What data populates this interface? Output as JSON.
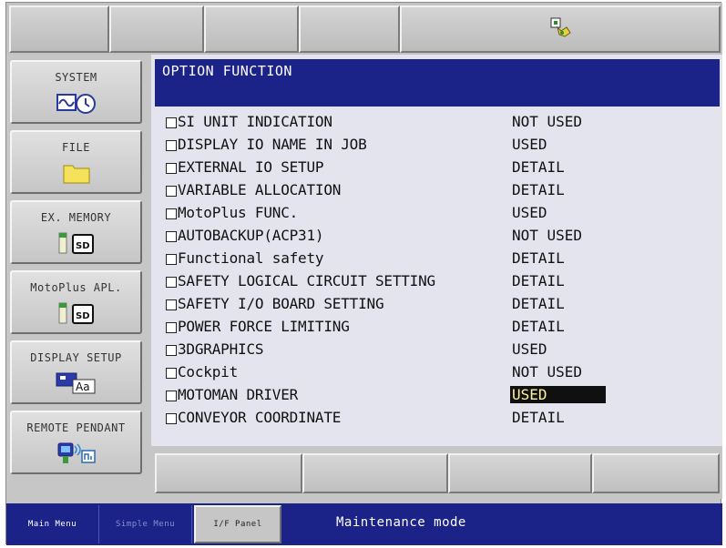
{
  "header": {
    "status_icon": "robot-status-icon"
  },
  "left_menu": {
    "items": [
      {
        "label": "SYSTEM",
        "icon": "system-clock-icon"
      },
      {
        "label": "FILE",
        "icon": "folder-icon"
      },
      {
        "label": "EX. MEMORY",
        "icon": "sd-card-icon"
      },
      {
        "label": "MotoPlus APL.",
        "icon": "sd-card-icon"
      },
      {
        "label": "DISPLAY SETUP",
        "icon": "display-font-icon"
      },
      {
        "label": "REMOTE PENDANT",
        "icon": "remote-pendant-icon"
      }
    ]
  },
  "main": {
    "title": "OPTION FUNCTION",
    "options": [
      {
        "name": "SI UNIT INDICATION",
        "value": "NOT USED"
      },
      {
        "name": "DISPLAY IO NAME IN JOB",
        "value": "USED"
      },
      {
        "name": "EXTERNAL IO SETUP",
        "value": "DETAIL"
      },
      {
        "name": "VARIABLE ALLOCATION",
        "value": "DETAIL"
      },
      {
        "name": "MotoPlus FUNC.",
        "value": "USED"
      },
      {
        "name": "AUTOBACKUP(ACP31)",
        "value": "NOT USED"
      },
      {
        "name": "Functional safety",
        "value": "DETAIL"
      },
      {
        "name": "SAFETY LOGICAL CIRCUIT SETTING",
        "value": "DETAIL"
      },
      {
        "name": "SAFETY I/O BOARD SETTING",
        "value": "DETAIL"
      },
      {
        "name": "POWER FORCE LIMITING",
        "value": "DETAIL"
      },
      {
        "name": "3DGRAPHICS",
        "value": "USED"
      },
      {
        "name": "Cockpit",
        "value": "NOT USED"
      },
      {
        "name": "MOTOMAN DRIVER",
        "value": "USED",
        "selected": true
      },
      {
        "name": "CONVEYOR COORDINATE",
        "value": "DETAIL"
      }
    ]
  },
  "status_bar": {
    "main_menu": "Main Menu",
    "simple_menu": "Simple Menu",
    "if_panel": "I/F Panel",
    "message": "Maintenance mode"
  },
  "colors": {
    "title_bar": "#1b2389",
    "status_bar": "#1b2389",
    "panel_bg": "#e4e4ee",
    "chrome": "#c6c6c6",
    "selected_bg": "#101010",
    "selected_text": "#fff3a0"
  }
}
